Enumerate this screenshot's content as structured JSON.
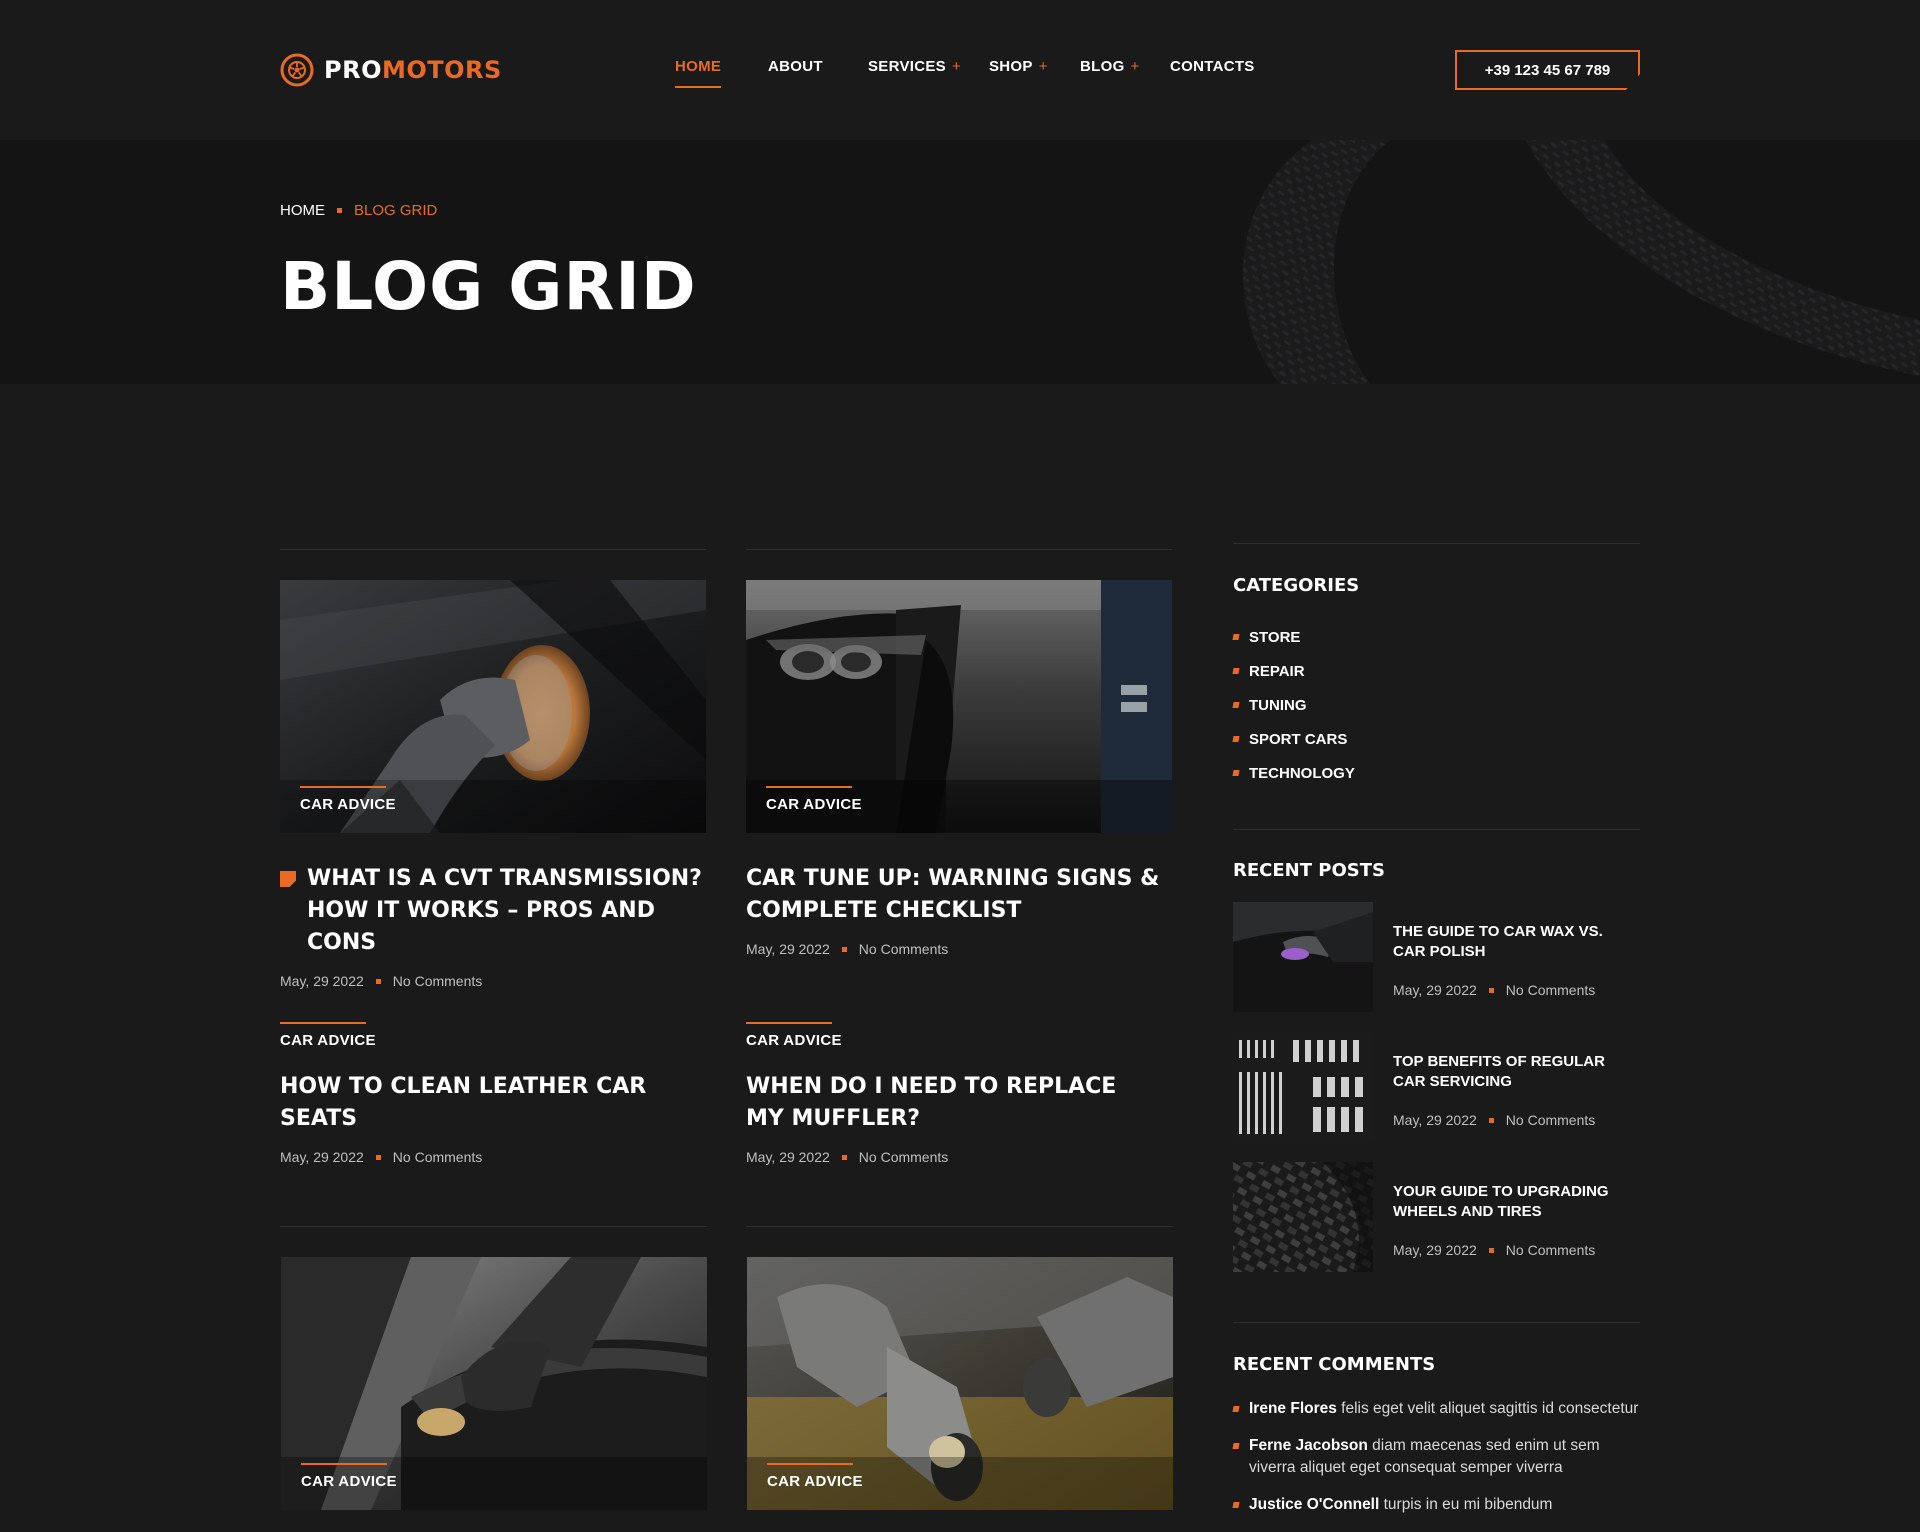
{
  "brand": {
    "pro": "PRO",
    "motors": "MOTORS"
  },
  "nav": {
    "items": [
      {
        "label": "HOME",
        "has_sub": false,
        "active": true
      },
      {
        "label": "ABOUT",
        "has_sub": false
      },
      {
        "label": "SERVICES",
        "has_sub": true
      },
      {
        "label": "SHOP",
        "has_sub": true
      },
      {
        "label": "BLOG",
        "has_sub": true
      },
      {
        "label": "CONTACTS",
        "has_sub": false
      }
    ],
    "plus": "+"
  },
  "phone": "+39 123 45 67 789",
  "breadcrumb": {
    "home": "HOME",
    "current": "BLOG GRID"
  },
  "page_title": "BLOG GRID",
  "posts": [
    {
      "category": "CAR ADVICE",
      "title": "WHAT IS A CVT TRANSMISSION? HOW IT WORKS – PROS AND CONS",
      "date": "May, 29 2022",
      "comments": "No Comments",
      "sticky": true,
      "image": "polisher-on-car"
    },
    {
      "category": "CAR ADVICE",
      "title": "CAR TUNE UP: WARNING SIGNS & COMPLETE CHECKLIST",
      "date": "May, 29 2022",
      "comments": "No Comments",
      "image": "car-headlight-garage"
    },
    {
      "category": "CAR ADVICE",
      "title": "HOW TO CLEAN LEATHER CAR SEATS",
      "date": "May, 29 2022",
      "comments": "No Comments"
    },
    {
      "category": "CAR ADVICE",
      "title": "WHEN DO I NEED TO REPLACE MY MUFFLER?",
      "date": "May, 29 2022",
      "comments": "No Comments"
    },
    {
      "category": "CAR ADVICE",
      "image": "cleaning-car-door"
    },
    {
      "category": "CAR ADVICE",
      "image": "polishers-closeup"
    }
  ],
  "sidebar": {
    "categories_title": "CATEGORIES",
    "categories": [
      "STORE",
      "REPAIR",
      "TUNING",
      "SPORT CARS",
      "TECHNOLOGY"
    ],
    "recent_posts_title": "RECENT POSTS",
    "recent_posts": [
      {
        "title": "THE GUIDE TO CAR WAX VS. CAR POLISH",
        "date": "May, 29 2022",
        "comments": "No Comments",
        "image": "waxing-car"
      },
      {
        "title": "TOP BENEFITS OF REGULAR CAR SERVICING",
        "date": "May, 29 2022",
        "comments": "No Comments",
        "image": "tool-set"
      },
      {
        "title": "YOUR GUIDE TO UPGRADING WHEELS AND TIRES",
        "date": "May, 29 2022",
        "comments": "No Comments",
        "image": "tire-tread"
      }
    ],
    "recent_comments_title": "RECENT COMMENTS",
    "recent_comments": [
      {
        "author": "Irene Flores",
        "text": " felis eget velit aliquet sagittis id consectetur"
      },
      {
        "author": "Ferne Jacobson",
        "text": " diam maecenas sed enim ut sem viverra aliquet eget consequat semper viverra"
      },
      {
        "author": "Justice O'Connell",
        "text": " turpis in eu mi bibendum"
      }
    ]
  },
  "colors": {
    "accent": "#e86a24",
    "background": "#1a1a1b",
    "hero_background": "#141415"
  }
}
